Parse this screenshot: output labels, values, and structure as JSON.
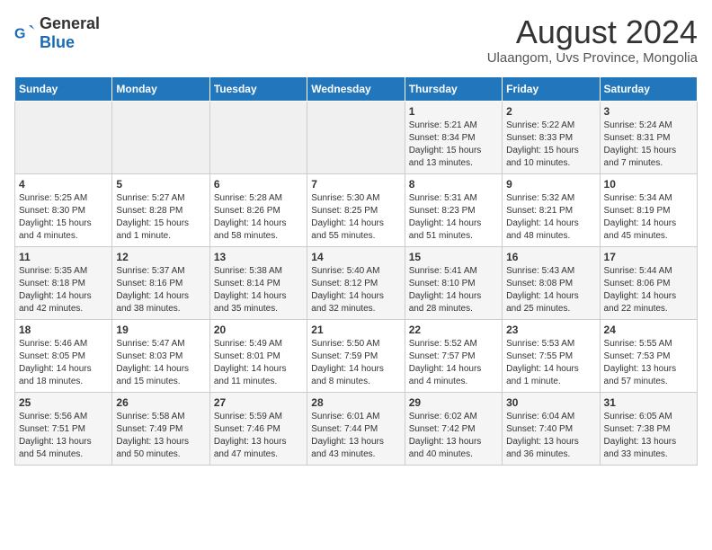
{
  "logo": {
    "general": "General",
    "blue": "Blue"
  },
  "title": "August 2024",
  "subtitle": "Ulaangom, Uvs Province, Mongolia",
  "headers": [
    "Sunday",
    "Monday",
    "Tuesday",
    "Wednesday",
    "Thursday",
    "Friday",
    "Saturday"
  ],
  "weeks": [
    [
      {
        "day": "",
        "info": ""
      },
      {
        "day": "",
        "info": ""
      },
      {
        "day": "",
        "info": ""
      },
      {
        "day": "",
        "info": ""
      },
      {
        "day": "1",
        "info": "Sunrise: 5:21 AM\nSunset: 8:34 PM\nDaylight: 15 hours\nand 13 minutes."
      },
      {
        "day": "2",
        "info": "Sunrise: 5:22 AM\nSunset: 8:33 PM\nDaylight: 15 hours\nand 10 minutes."
      },
      {
        "day": "3",
        "info": "Sunrise: 5:24 AM\nSunset: 8:31 PM\nDaylight: 15 hours\nand 7 minutes."
      }
    ],
    [
      {
        "day": "4",
        "info": "Sunrise: 5:25 AM\nSunset: 8:30 PM\nDaylight: 15 hours\nand 4 minutes."
      },
      {
        "day": "5",
        "info": "Sunrise: 5:27 AM\nSunset: 8:28 PM\nDaylight: 15 hours\nand 1 minute."
      },
      {
        "day": "6",
        "info": "Sunrise: 5:28 AM\nSunset: 8:26 PM\nDaylight: 14 hours\nand 58 minutes."
      },
      {
        "day": "7",
        "info": "Sunrise: 5:30 AM\nSunset: 8:25 PM\nDaylight: 14 hours\nand 55 minutes."
      },
      {
        "day": "8",
        "info": "Sunrise: 5:31 AM\nSunset: 8:23 PM\nDaylight: 14 hours\nand 51 minutes."
      },
      {
        "day": "9",
        "info": "Sunrise: 5:32 AM\nSunset: 8:21 PM\nDaylight: 14 hours\nand 48 minutes."
      },
      {
        "day": "10",
        "info": "Sunrise: 5:34 AM\nSunset: 8:19 PM\nDaylight: 14 hours\nand 45 minutes."
      }
    ],
    [
      {
        "day": "11",
        "info": "Sunrise: 5:35 AM\nSunset: 8:18 PM\nDaylight: 14 hours\nand 42 minutes."
      },
      {
        "day": "12",
        "info": "Sunrise: 5:37 AM\nSunset: 8:16 PM\nDaylight: 14 hours\nand 38 minutes."
      },
      {
        "day": "13",
        "info": "Sunrise: 5:38 AM\nSunset: 8:14 PM\nDaylight: 14 hours\nand 35 minutes."
      },
      {
        "day": "14",
        "info": "Sunrise: 5:40 AM\nSunset: 8:12 PM\nDaylight: 14 hours\nand 32 minutes."
      },
      {
        "day": "15",
        "info": "Sunrise: 5:41 AM\nSunset: 8:10 PM\nDaylight: 14 hours\nand 28 minutes."
      },
      {
        "day": "16",
        "info": "Sunrise: 5:43 AM\nSunset: 8:08 PM\nDaylight: 14 hours\nand 25 minutes."
      },
      {
        "day": "17",
        "info": "Sunrise: 5:44 AM\nSunset: 8:06 PM\nDaylight: 14 hours\nand 22 minutes."
      }
    ],
    [
      {
        "day": "18",
        "info": "Sunrise: 5:46 AM\nSunset: 8:05 PM\nDaylight: 14 hours\nand 18 minutes."
      },
      {
        "day": "19",
        "info": "Sunrise: 5:47 AM\nSunset: 8:03 PM\nDaylight: 14 hours\nand 15 minutes."
      },
      {
        "day": "20",
        "info": "Sunrise: 5:49 AM\nSunset: 8:01 PM\nDaylight: 14 hours\nand 11 minutes."
      },
      {
        "day": "21",
        "info": "Sunrise: 5:50 AM\nSunset: 7:59 PM\nDaylight: 14 hours\nand 8 minutes."
      },
      {
        "day": "22",
        "info": "Sunrise: 5:52 AM\nSunset: 7:57 PM\nDaylight: 14 hours\nand 4 minutes."
      },
      {
        "day": "23",
        "info": "Sunrise: 5:53 AM\nSunset: 7:55 PM\nDaylight: 14 hours\nand 1 minute."
      },
      {
        "day": "24",
        "info": "Sunrise: 5:55 AM\nSunset: 7:53 PM\nDaylight: 13 hours\nand 57 minutes."
      }
    ],
    [
      {
        "day": "25",
        "info": "Sunrise: 5:56 AM\nSunset: 7:51 PM\nDaylight: 13 hours\nand 54 minutes."
      },
      {
        "day": "26",
        "info": "Sunrise: 5:58 AM\nSunset: 7:49 PM\nDaylight: 13 hours\nand 50 minutes."
      },
      {
        "day": "27",
        "info": "Sunrise: 5:59 AM\nSunset: 7:46 PM\nDaylight: 13 hours\nand 47 minutes."
      },
      {
        "day": "28",
        "info": "Sunrise: 6:01 AM\nSunset: 7:44 PM\nDaylight: 13 hours\nand 43 minutes."
      },
      {
        "day": "29",
        "info": "Sunrise: 6:02 AM\nSunset: 7:42 PM\nDaylight: 13 hours\nand 40 minutes."
      },
      {
        "day": "30",
        "info": "Sunrise: 6:04 AM\nSunset: 7:40 PM\nDaylight: 13 hours\nand 36 minutes."
      },
      {
        "day": "31",
        "info": "Sunrise: 6:05 AM\nSunset: 7:38 PM\nDaylight: 13 hours\nand 33 minutes."
      }
    ]
  ]
}
